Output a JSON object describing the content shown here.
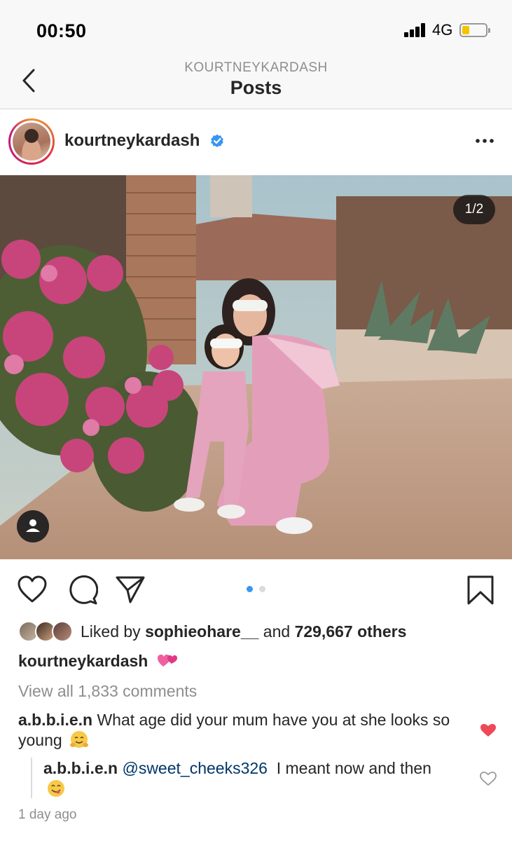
{
  "status_bar": {
    "time": "00:50",
    "network": "4G",
    "battery_color": "#f5c400"
  },
  "nav": {
    "subtitle": "KOURTNEYKARDASH",
    "title": "Posts",
    "back_icon": "chevron-left-icon"
  },
  "post": {
    "username": "kourtneykardash",
    "verified_color": "#3897f0",
    "media_counter": "1/2",
    "carousel": {
      "count": 2,
      "active_index": 0,
      "active_color": "#3897f0",
      "inactive_color": "#dbdbdb"
    }
  },
  "actions": {
    "like_icon": "heart-icon",
    "comment_icon": "comment-icon",
    "share_icon": "send-icon",
    "save_icon": "bookmark-icon"
  },
  "likes": {
    "prefix": "Liked by ",
    "first_user": "sophieohare__",
    "middle": " and ",
    "others": "729,667 others"
  },
  "caption": {
    "username": "kourtneykardash",
    "emoji": "two-hearts-emoji"
  },
  "view_all_comments": "View all 1,833 comments",
  "comments": [
    {
      "username": "a.b.b.i.e.n",
      "text": "What age did your mum have you at she looks so young",
      "emoji": "hugging-face-emoji",
      "liked": true,
      "like_color": "#ed4956"
    },
    {
      "username": "a.b.b.i.e.n",
      "mention": "@sweet_cheeks326",
      "text": "I meant now and then",
      "emoji": "yum-face-emoji",
      "liked": false
    }
  ],
  "timestamp": "1 day ago"
}
